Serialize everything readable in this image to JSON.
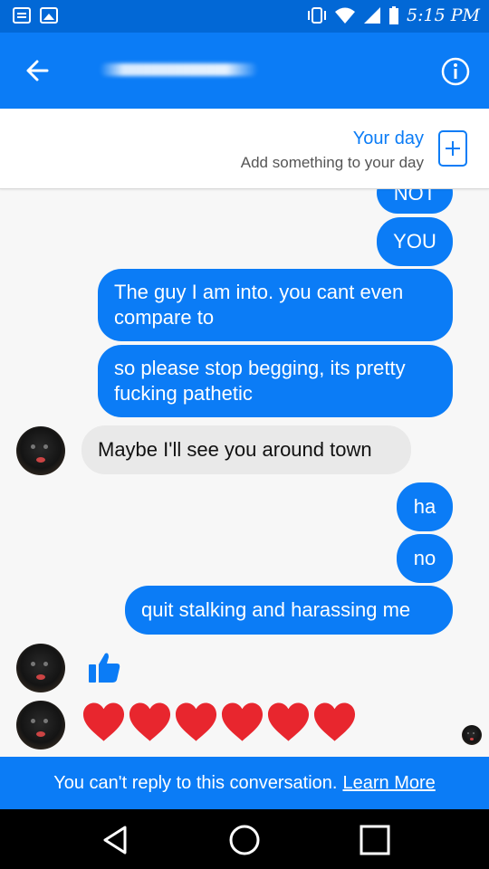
{
  "status_bar": {
    "time": "5:15 PM"
  },
  "header": {
    "back_icon": "arrow-left-icon",
    "info_icon": "info-icon"
  },
  "your_day": {
    "title": "Your day",
    "subtitle": "Add something to your day",
    "add_icon": "plus-box-icon"
  },
  "messages": [
    {
      "from": "me",
      "text": "NOT"
    },
    {
      "from": "me",
      "text": "YOU"
    },
    {
      "from": "me",
      "text": "The guy I am into. you cant even compare to"
    },
    {
      "from": "me",
      "text": "so please stop begging, its pretty fucking pathetic"
    },
    {
      "from": "them",
      "text": "Maybe I'll see you around town"
    },
    {
      "from": "me",
      "text": "ha"
    },
    {
      "from": "me",
      "text": "no"
    },
    {
      "from": "me",
      "text": "quit stalking and harassing me"
    },
    {
      "from": "them",
      "sticker": "thumbs-up-icon"
    },
    {
      "from": "them",
      "sticker": "heart-icon",
      "count": 6
    }
  ],
  "footer": {
    "notice": "You can't reply to this conversation.",
    "link": "Learn More"
  },
  "nav": {
    "back": "nav-back-icon",
    "home": "nav-home-icon",
    "recents": "nav-recents-icon"
  },
  "colors": {
    "messenger_blue": "#0b7cf6",
    "status_blue": "#0268d6",
    "incoming_bubble": "#e9e9e9",
    "heart_red": "#e8262e"
  }
}
